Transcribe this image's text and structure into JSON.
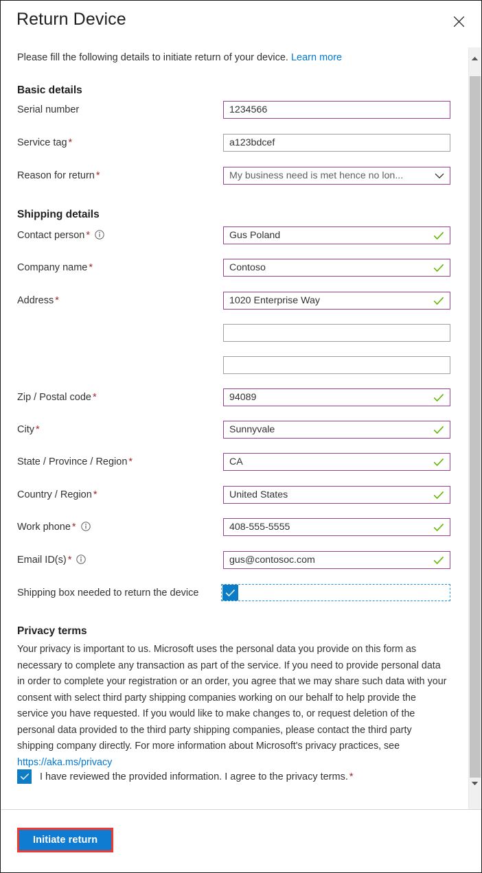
{
  "panel": {
    "title": "Return Device",
    "close_icon": "close-icon",
    "intro_text": "Please fill the following details to initiate return of your device.",
    "intro_link": "Learn more"
  },
  "sections": {
    "basic": {
      "heading": "Basic details",
      "fields": [
        {
          "label": "Serial number",
          "required": false,
          "info": false,
          "value": "1234566",
          "accent": true,
          "valid": false,
          "type": "text"
        },
        {
          "label": "Service tag",
          "required": true,
          "info": false,
          "value": "a123bdcef",
          "accent": false,
          "valid": false,
          "type": "text"
        },
        {
          "label": "Reason for return",
          "required": true,
          "info": false,
          "value": "My business need is met hence no lon...",
          "accent": true,
          "valid": false,
          "type": "select",
          "placeholder_style": true
        }
      ]
    },
    "shipping": {
      "heading": "Shipping details",
      "fields": [
        {
          "label": "Contact person",
          "required": true,
          "info": true,
          "value": "Gus Poland",
          "accent": true,
          "valid": true,
          "type": "text"
        },
        {
          "label": "Company name",
          "required": true,
          "info": false,
          "value": "Contoso",
          "accent": true,
          "valid": true,
          "type": "text"
        },
        {
          "label": "Address",
          "required": true,
          "info": false,
          "value": "1020 Enterprise Way",
          "accent": true,
          "valid": true,
          "type": "text"
        },
        {
          "label": "",
          "required": false,
          "info": false,
          "value": "",
          "accent": false,
          "valid": false,
          "type": "text"
        },
        {
          "label": "",
          "required": false,
          "info": false,
          "value": "",
          "accent": false,
          "valid": false,
          "type": "text"
        },
        {
          "label": "Zip / Postal code",
          "required": true,
          "info": false,
          "value": "94089",
          "accent": true,
          "valid": true,
          "type": "text"
        },
        {
          "label": "City",
          "required": true,
          "info": false,
          "value": "Sunnyvale",
          "accent": true,
          "valid": true,
          "type": "text"
        },
        {
          "label": "State / Province / Region",
          "required": true,
          "info": false,
          "value": "CA",
          "accent": true,
          "valid": true,
          "type": "text"
        },
        {
          "label": "Country / Region",
          "required": true,
          "info": false,
          "value": "United States",
          "accent": true,
          "valid": true,
          "type": "text"
        },
        {
          "label": "Work phone",
          "required": true,
          "info": true,
          "value": "408-555-5555",
          "accent": true,
          "valid": true,
          "type": "text"
        },
        {
          "label": "Email ID(s)",
          "required": true,
          "info": true,
          "value": "gus@contosoc.com",
          "accent": true,
          "valid": true,
          "type": "text"
        }
      ],
      "shipping_box": {
        "label": "Shipping box needed to return the device",
        "checked": true,
        "focused": true
      }
    },
    "privacy": {
      "heading": "Privacy terms",
      "body_1": "Your privacy is important to us. Microsoft uses the personal data you provide on this form as necessary to complete any transaction as part of the service. If you need to provide personal data in order to complete your registration or an order, you agree that we may share such data with your consent with select third party shipping companies working on our behalf to help provide the service you have requested. If you would like to make changes to, or request deletion of the personal data provided to the third party shipping companies, please contact the third party shipping company directly. For more information about Microsoft's privacy practices, see ",
      "body_link": "https://aka.ms/privacy",
      "agree_label": "I have reviewed the provided information. I agree to the privacy terms.",
      "agree_checked": true
    }
  },
  "footer": {
    "submit_label": "Initiate return"
  },
  "scrollbar": {
    "up_icon": "caret-up-icon",
    "down_icon": "caret-down-icon"
  },
  "colors": {
    "accent_border": "#9b3e96",
    "neutral_border": "#a19f9d",
    "valid_green": "#62b400",
    "link_blue": "#0078d4",
    "primary_blue": "#0f7bd1",
    "required_red": "#a4262c",
    "highlight_red": "#f03a2e",
    "focus_blue": "#1a93e8"
  }
}
